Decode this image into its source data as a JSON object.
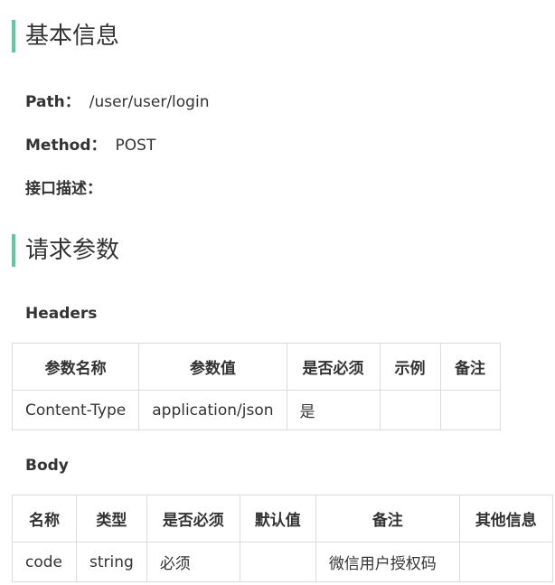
{
  "basic_info": {
    "title": "基本信息",
    "path_label": "Path：",
    "path_value": "/user/user/login",
    "method_label": "Method：",
    "method_value": "POST",
    "desc_label": "接口描述："
  },
  "request_params": {
    "title": "请求参数",
    "headers_label": "Headers",
    "headers_table": {
      "columns": [
        "参数名称",
        "参数值",
        "是否必须",
        "示例",
        "备注"
      ],
      "rows": [
        [
          "Content-Type",
          "application/json",
          "是",
          "",
          ""
        ]
      ]
    },
    "body_label": "Body",
    "body_table": {
      "columns": [
        "名称",
        "类型",
        "是否必须",
        "默认值",
        "备注",
        "其他信息"
      ],
      "rows": [
        [
          "code",
          "string",
          "必须",
          "",
          "微信用户授权码",
          ""
        ]
      ]
    }
  },
  "colors": {
    "accent": "#5dc99e",
    "border": "#dcdcdc",
    "text": "#333333"
  }
}
